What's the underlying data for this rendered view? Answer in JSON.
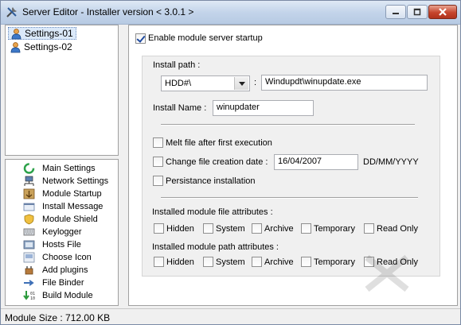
{
  "window": {
    "title": "Server Editor - Installer version < 3.0.1 >"
  },
  "settings_list": {
    "items": [
      {
        "label": "Settings-01",
        "selected": true
      },
      {
        "label": "Settings-02",
        "selected": false
      }
    ]
  },
  "modules": {
    "items": [
      {
        "label": "Main Settings",
        "icon": "globe-refresh-icon"
      },
      {
        "label": "Network Settings",
        "icon": "network-icon"
      },
      {
        "label": "Module Startup",
        "icon": "startup-box-icon"
      },
      {
        "label": "Install Message",
        "icon": "message-icon"
      },
      {
        "label": "Module Shield",
        "icon": "shield-icon"
      },
      {
        "label": "Keylogger",
        "icon": "keyboard-icon"
      },
      {
        "label": "Hosts File",
        "icon": "hosts-file-icon"
      },
      {
        "label": "Choose Icon",
        "icon": "choose-icon-icon"
      },
      {
        "label": "Add plugins",
        "icon": "plugin-icon"
      },
      {
        "label": "File Binder",
        "icon": "file-binder-icon"
      },
      {
        "label": "Build Module",
        "icon": "build-binary-icon"
      }
    ]
  },
  "startup": {
    "enable_label": "Enable module server startup",
    "enable_checked": true,
    "install_path_label": "Install path :",
    "drive_value": "HDD#\\",
    "separator": ":",
    "path_value": "Windupdt\\winupdate.exe",
    "install_name_label": "Install Name :",
    "install_name_value": "winupdater",
    "melt_label": "Melt file after first execution",
    "change_date_label": "Change file creation date :",
    "date_value": "16/04/2007",
    "date_format": "DD/MM/YYYY",
    "persistance_label": "Persistance installation",
    "file_attr_title": "Installed module file attributes :",
    "path_attr_title": "Installed module path attributes :",
    "attributes": [
      "Hidden",
      "System",
      "Archive",
      "Temporary",
      "Read Only"
    ]
  },
  "status": {
    "module_size": "Module Size : 712.00 KB"
  },
  "colors": {
    "titlebar": "#c3d4ea",
    "selection": "#dbe9f9",
    "check_mark": "#1f4aa0",
    "close_button": "#c6452d"
  }
}
